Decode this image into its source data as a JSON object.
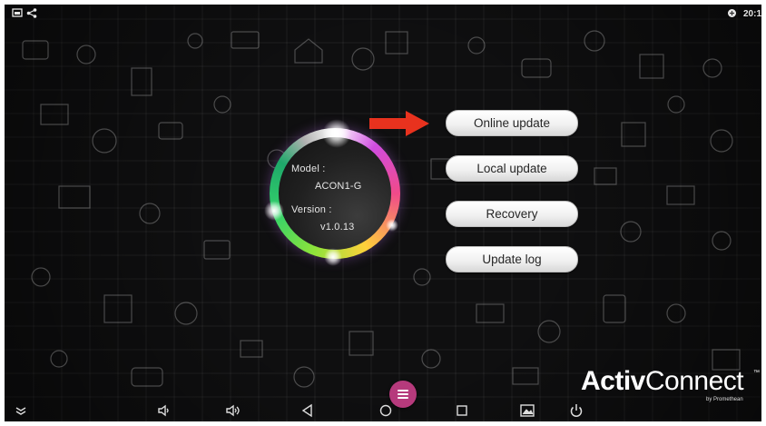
{
  "status_bar": {
    "left_icons": [
      "screenshot-icon",
      "share-icon"
    ],
    "right_icons": [
      "network-icon"
    ],
    "clock": "20:1"
  },
  "device_info": {
    "model_label": "Model :",
    "model_value": "ACON1-G",
    "version_label": "Version :",
    "version_value": "v1.0.13"
  },
  "menu": {
    "online_update": "Online update",
    "local_update": "Local update",
    "recovery": "Recovery",
    "update_log": "Update log"
  },
  "pointer": {
    "icon": "red-arrow-icon",
    "color": "#e8321e"
  },
  "fab": {
    "icon": "menu-icon",
    "color": "#b63a7c"
  },
  "brand": {
    "name_bold": "Activ",
    "name_light": "Connect",
    "trademark": "™",
    "sub": "by Promethean"
  },
  "nav_bar": {
    "icons": [
      "collapse-icon",
      "volume-down-icon",
      "volume-up-icon",
      "back-icon",
      "home-icon",
      "recent-apps-icon",
      "screenshot-icon",
      "power-icon"
    ]
  }
}
